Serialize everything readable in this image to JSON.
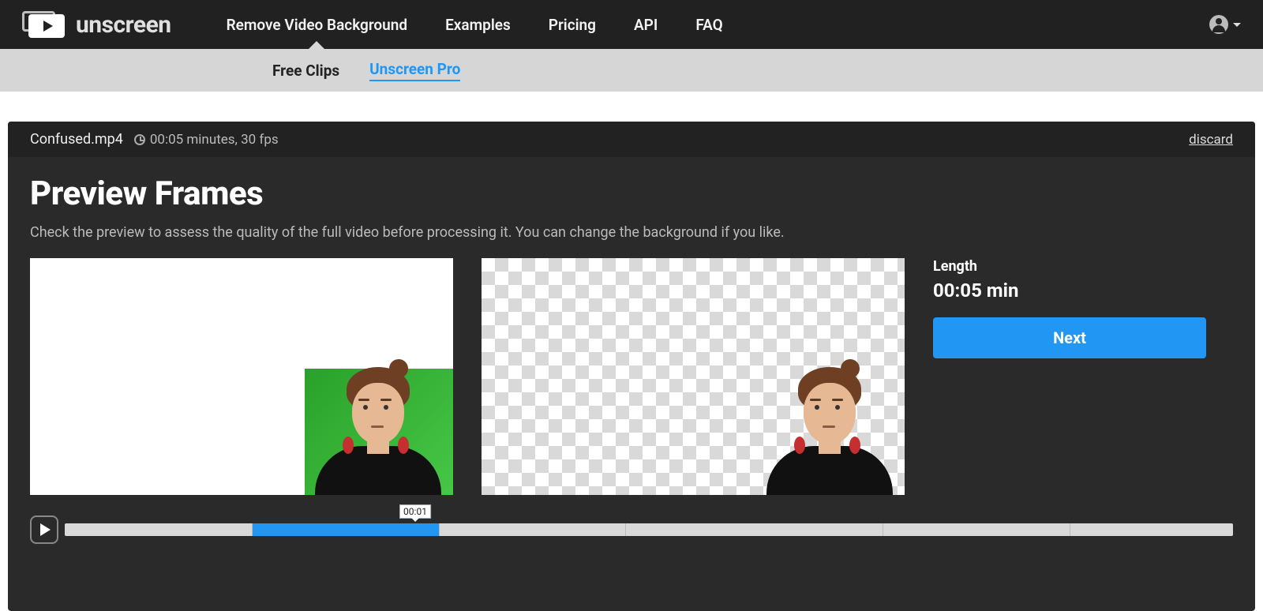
{
  "brand": "unscreen",
  "nav": {
    "items": [
      "Remove Video Background",
      "Examples",
      "Pricing",
      "API",
      "FAQ"
    ],
    "activeIndex": 0
  },
  "subnav": {
    "items": [
      "Free Clips",
      "Unscreen Pro"
    ],
    "activeIndex": 1
  },
  "file": {
    "name": "Confused.mp4",
    "meta": "00:05 minutes, 30 fps"
  },
  "discardLabel": "discard",
  "page": {
    "title": "Preview Frames",
    "subtitle": "Check the preview to assess the quality of the full video before processing it. You can change the background if you like."
  },
  "side": {
    "lengthLabel": "Length",
    "lengthValue": "00:05 min",
    "nextLabel": "Next"
  },
  "timeline": {
    "markerLabel": "00:01",
    "markerPercent": 30,
    "progressStartPercent": 16,
    "progressEndPercent": 32,
    "ticksPercent": [
      16,
      32,
      48,
      70,
      86
    ]
  }
}
